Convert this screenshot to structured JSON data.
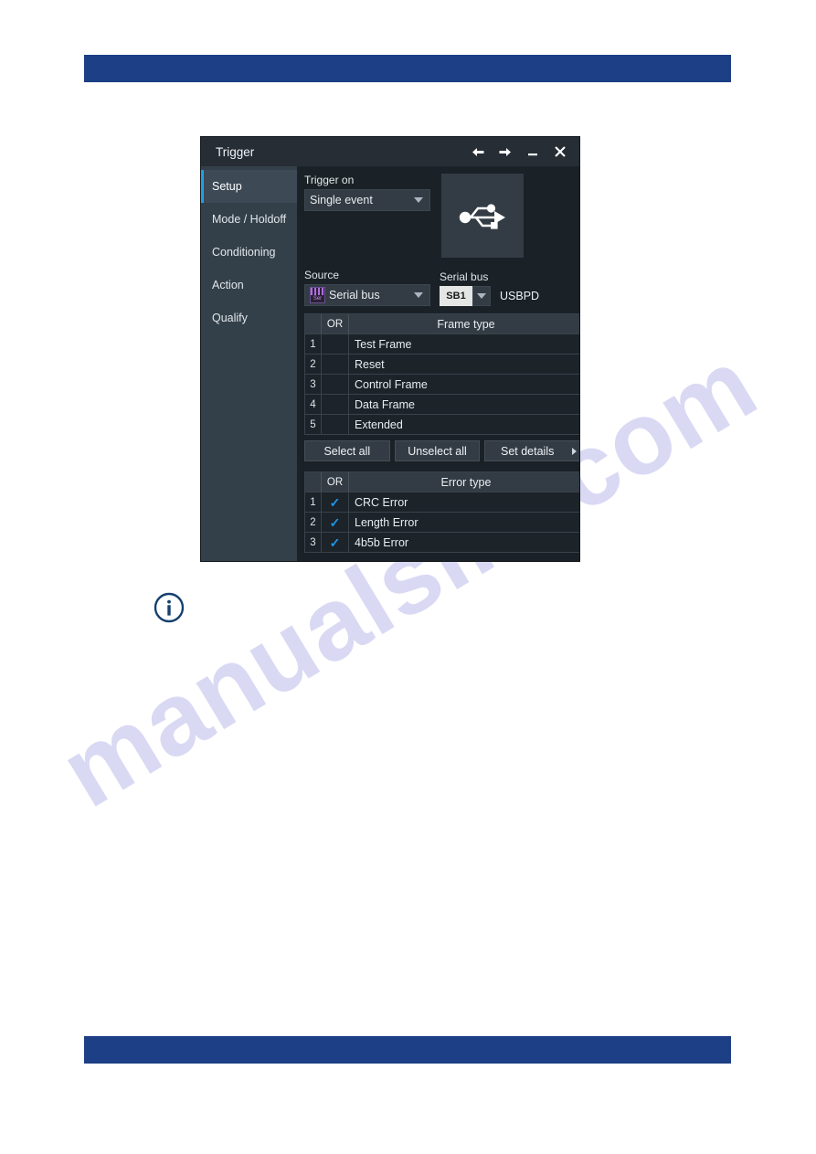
{
  "page": {
    "watermark": "manualslib.com",
    "info_icon": "info-circle-icon"
  },
  "dialog": {
    "title": "Trigger",
    "titlebar_buttons": [
      {
        "name": "back-button",
        "glyph": "←"
      },
      {
        "name": "forward-button",
        "glyph": "→"
      },
      {
        "name": "minimize-button",
        "glyph": "—"
      },
      {
        "name": "close-button",
        "glyph": "✕"
      }
    ],
    "sidebar": {
      "items": [
        {
          "label": "Setup",
          "active": true
        },
        {
          "label": "Mode / Holdoff",
          "active": false
        },
        {
          "label": "Conditioning",
          "active": false
        },
        {
          "label": "Action",
          "active": false
        },
        {
          "label": "Qualify",
          "active": false
        }
      ]
    },
    "trigger_on": {
      "label": "Trigger on",
      "value": "Single event"
    },
    "protocol_icon": "usb-trident-icon",
    "source": {
      "label": "Source",
      "value": "Serial bus",
      "icon": "serial-bus-icon",
      "icon_text": "Ser"
    },
    "serial_bus": {
      "label": "Serial bus",
      "button": "SB1",
      "name": "USBPD"
    },
    "frame_table": {
      "headers": [
        "",
        "OR",
        "Frame type"
      ],
      "rows": [
        {
          "index": "1",
          "checked": false,
          "name": "Test Frame"
        },
        {
          "index": "2",
          "checked": false,
          "name": "Reset"
        },
        {
          "index": "3",
          "checked": false,
          "name": "Control Frame"
        },
        {
          "index": "4",
          "checked": false,
          "name": "Data Frame"
        },
        {
          "index": "5",
          "checked": false,
          "name": "Extended"
        }
      ]
    },
    "frame_buttons": {
      "select_all": "Select all",
      "unselect_all": "Unselect all",
      "set_details": "Set details"
    },
    "error_table": {
      "headers": [
        "",
        "OR",
        "Error type"
      ],
      "rows": [
        {
          "index": "1",
          "checked": true,
          "name": "CRC Error"
        },
        {
          "index": "2",
          "checked": true,
          "name": "Length Error"
        },
        {
          "index": "3",
          "checked": true,
          "name": "4b5b Error"
        }
      ]
    },
    "check_glyph": "✓"
  },
  "colors": {
    "band": "#1d3f85",
    "accent": "#1e9fe3",
    "panel": "#1a2127",
    "sidebar": "#344049",
    "check": "#2196e6",
    "watermark": "#d9d9f4"
  }
}
